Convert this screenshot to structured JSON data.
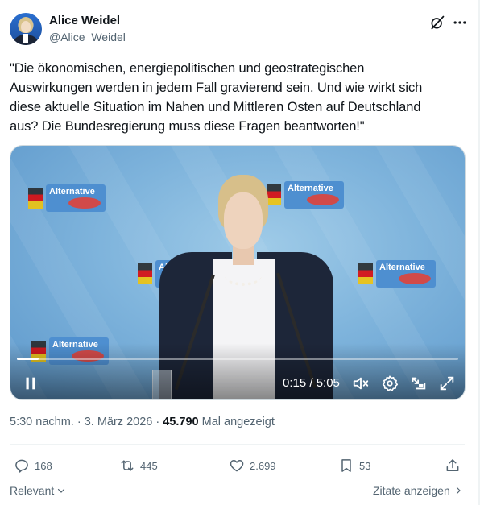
{
  "author": {
    "name": "Alice Weidel",
    "handle": "@Alice_Weidel"
  },
  "tweet": {
    "text": "\"Die ökonomischen, energiepolitischen und geostrategischen\nAuswirkungen werden in jedem Fall gravierend sein. Und wie wirkt sich\ndiese aktuelle Situation im Nahen und Mittleren Osten auf Deutschland\naus? Die Bundesregierung muss diese Fragen beantworten!\""
  },
  "video": {
    "time_display": "0:15 / 5:05",
    "progress": 0.05,
    "backdrop_brand": "Alternative",
    "controls": [
      "pause-icon",
      "mute-icon",
      "settings-icon",
      "pip-icon",
      "fullscreen-icon"
    ]
  },
  "meta": {
    "time": "5:30 nachm.",
    "date": "3. März 2026",
    "views": "45.790",
    "views_label": "Mal angezeigt"
  },
  "actions": {
    "replies": "168",
    "reposts": "445",
    "likes": "2.699",
    "bookmarks": "53"
  },
  "footer": {
    "sort_label": "Relevant",
    "quotes_label": "Zitate anzeigen"
  },
  "colors": {
    "text": "#0f1419",
    "secondary": "#536471",
    "divider": "#eff3f4",
    "video_bg": "#7fb4dc"
  }
}
